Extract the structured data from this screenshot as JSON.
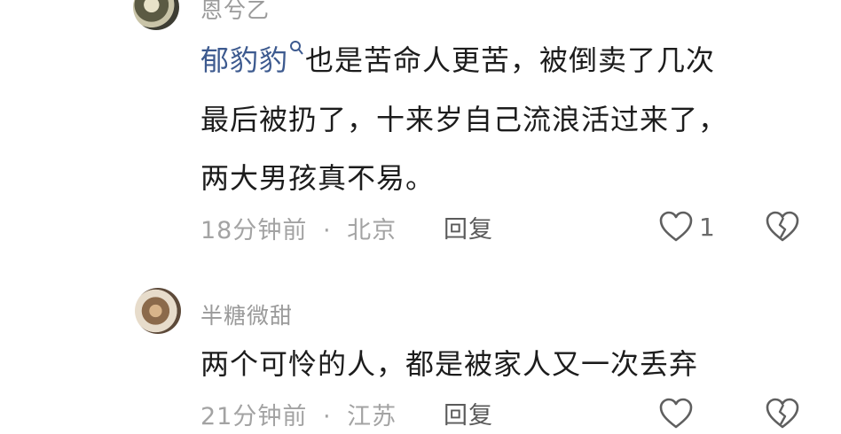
{
  "comments": [
    {
      "username": "恩兮乙",
      "mention": "郁豹豹",
      "text_line1": "也是苦命人更苦，被倒卖了几次",
      "text_line2": "最后被扔了，十来岁自己流浪活过来了，",
      "text_line3": "两大男孩真不易。",
      "time": "18分钟前",
      "location": "北京",
      "separator": "·",
      "reply_label": "回复",
      "like_count": "1"
    },
    {
      "username": "半糖微甜",
      "text_line1": "两个可怜的人，都是被家人又一次丢弃",
      "time": "21分钟前",
      "location": "江苏",
      "separator": "·",
      "reply_label": "回复"
    }
  ],
  "icons": {
    "like": "heart-outline-icon",
    "dislike": "broken-heart-icon",
    "mention": "search-icon"
  },
  "colors": {
    "mention": "#3d5a8f",
    "meta": "#a3a3a3",
    "text": "#1c1c1c"
  }
}
